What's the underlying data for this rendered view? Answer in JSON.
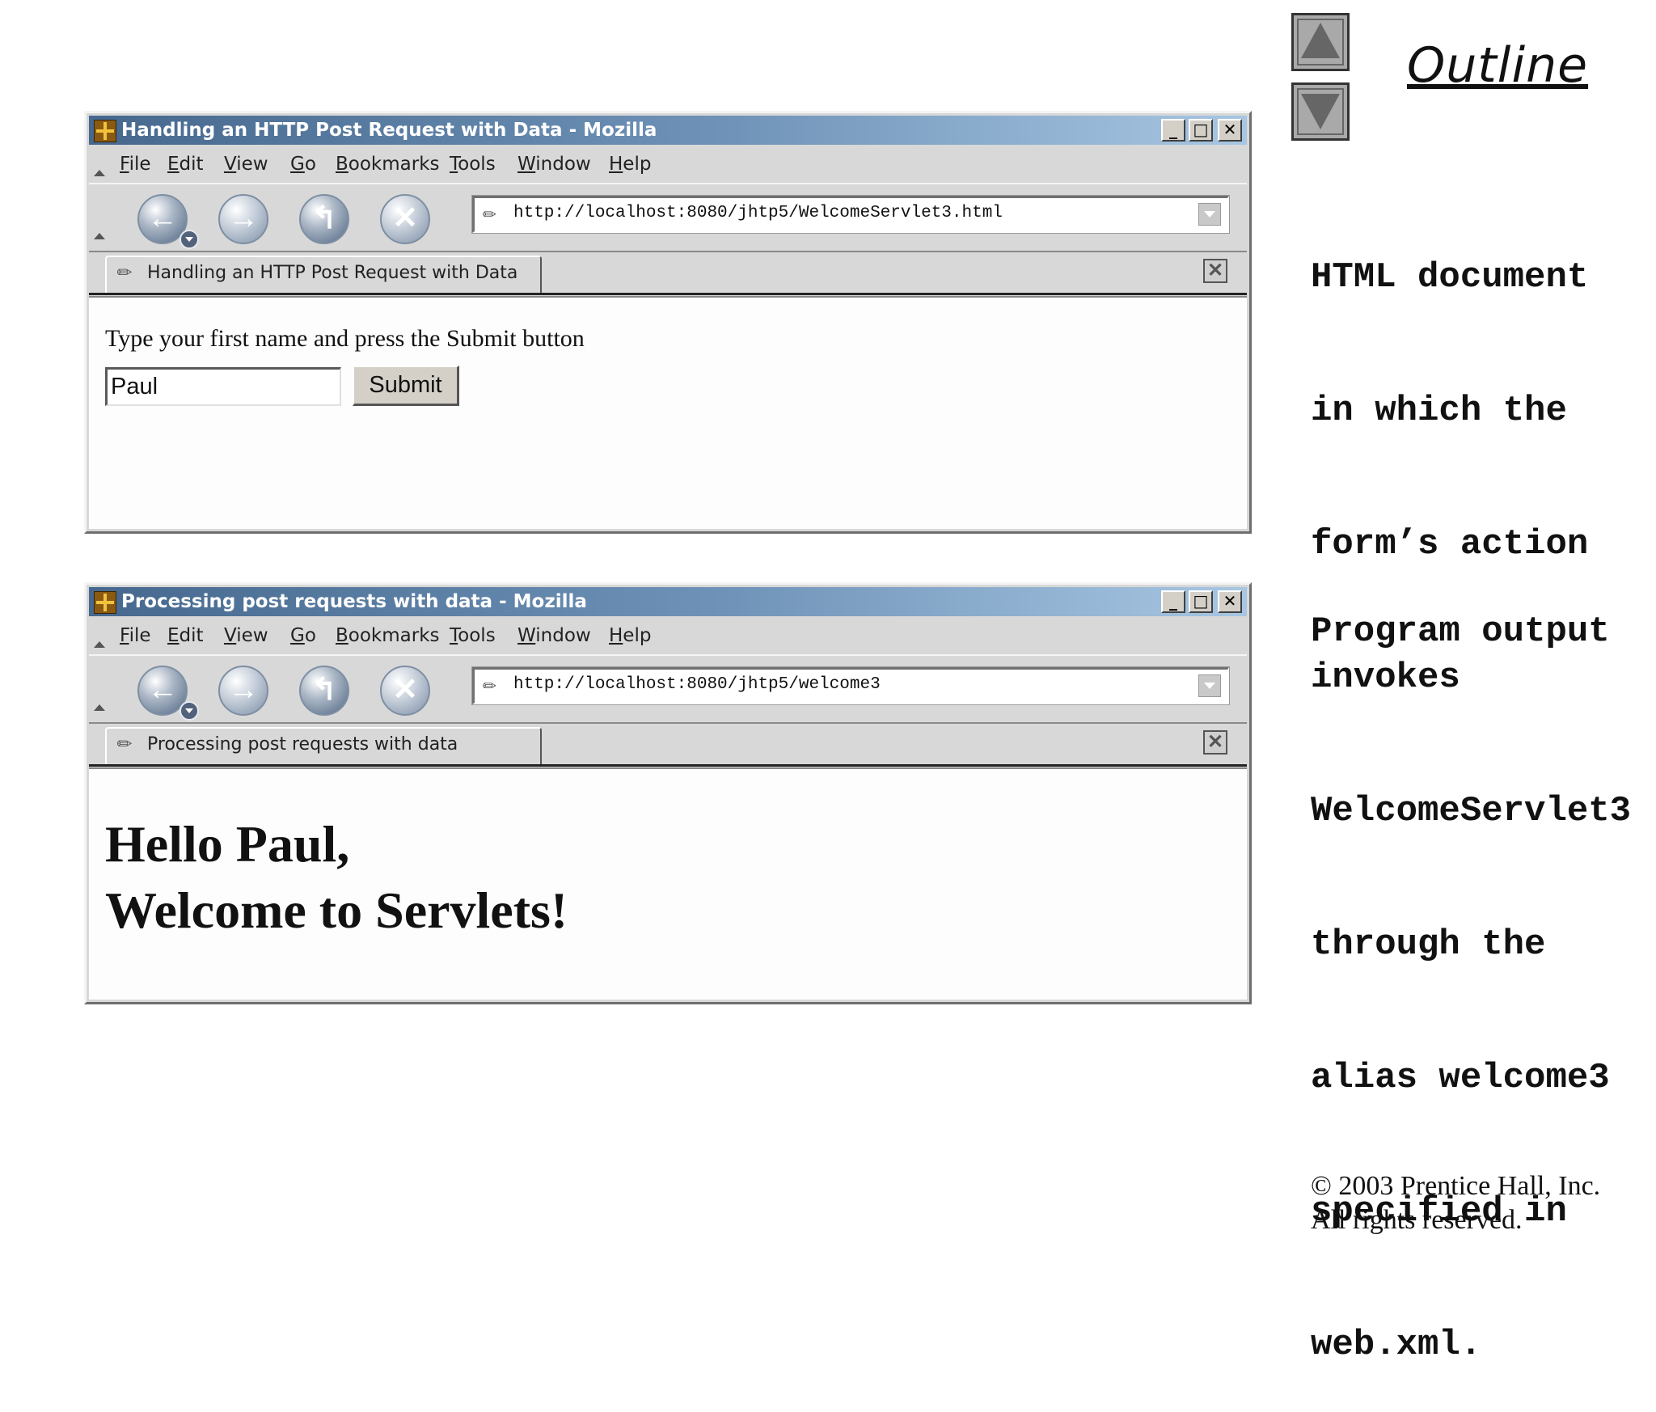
{
  "windows": [
    {
      "title": "Handling an HTTP Post Request with Data - Mozilla",
      "url": "http://localhost:8080/jhtp5/WelcomeServlet3.html",
      "tab_label": "Handling an HTTP Post Request with Data",
      "form": {
        "label": "Type your first name and press the Submit button",
        "input_value": "Paul",
        "submit_label": "Submit"
      }
    },
    {
      "title": "Processing post requests with data - Mozilla",
      "url": "http://localhost:8080/jhtp5/welcome3",
      "tab_label": "Processing post requests with data",
      "greeting_line1": "Hello Paul,",
      "greeting_line2": "Welcome to Servlets!"
    }
  ],
  "menu": [
    {
      "mnemonic": "F",
      "rest": "ile"
    },
    {
      "mnemonic": "E",
      "rest": "dit"
    },
    {
      "mnemonic": "V",
      "rest": "iew"
    },
    {
      "mnemonic": "G",
      "rest": "o"
    },
    {
      "mnemonic": "B",
      "rest": "ookmarks"
    },
    {
      "mnemonic": "T",
      "rest": "ools"
    },
    {
      "mnemonic": "W",
      "rest": "indow"
    },
    {
      "mnemonic": "H",
      "rest": "elp"
    }
  ],
  "nav_icons": {
    "back": "←",
    "forward": "→",
    "reload": "↰",
    "stop": "✕",
    "minimize": "_",
    "maximize": "□",
    "close": "✕",
    "page": "✎"
  },
  "side_panel": {
    "outline_title": "Outline",
    "notes": [
      "HTML document",
      "in which the",
      "form’s action",
      "invokes",
      "WelcomeServlet3",
      "through the",
      "alias welcome3",
      "specified in",
      "web.xml."
    ],
    "output_note": "Program output",
    "copyright_line1": "© 2003 Prentice Hall, Inc.",
    "copyright_line2": "All rights reserved."
  }
}
